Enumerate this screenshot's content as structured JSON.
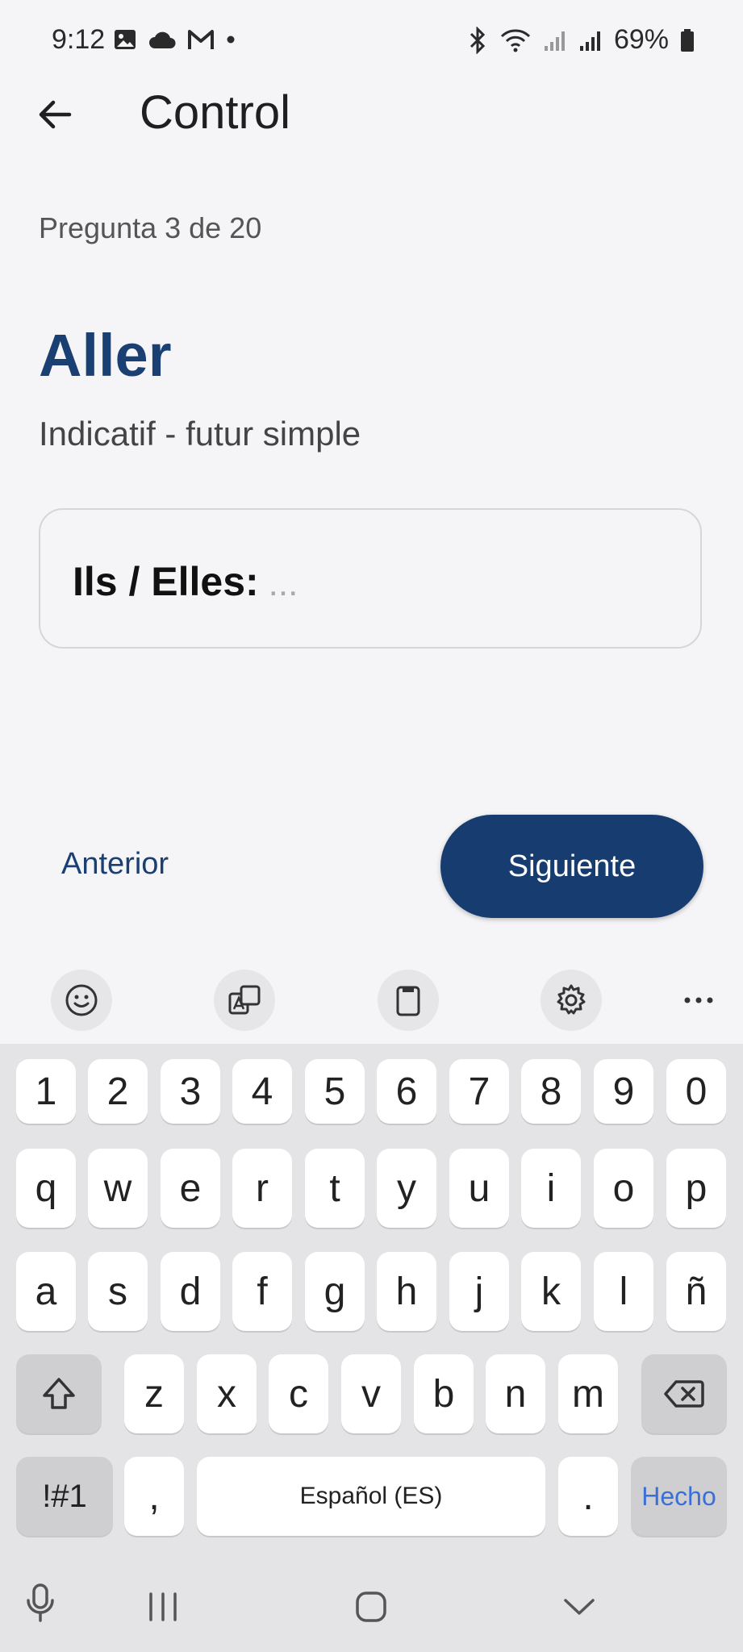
{
  "status_bar": {
    "time": "9:12",
    "battery": "69%"
  },
  "app_bar": {
    "title": "Control"
  },
  "quiz": {
    "progress": "Pregunta 3 de 20",
    "verb": "Aller",
    "tense": "Indicatif - futur simple",
    "prompt": "Ils / Elles:",
    "answer_placeholder": "..."
  },
  "buttons": {
    "previous": "Anterior",
    "next": "Siguiente"
  },
  "keyboard": {
    "number_row": [
      "1",
      "2",
      "3",
      "4",
      "5",
      "6",
      "7",
      "8",
      "9",
      "0"
    ],
    "row1": [
      "q",
      "w",
      "e",
      "r",
      "t",
      "y",
      "u",
      "i",
      "o",
      "p"
    ],
    "row2": [
      "a",
      "s",
      "d",
      "f",
      "g",
      "h",
      "j",
      "k",
      "l",
      "ñ"
    ],
    "row3": [
      "z",
      "x",
      "c",
      "v",
      "b",
      "n",
      "m"
    ],
    "symbols_label": "!#1",
    "comma": ",",
    "space_label": "Español (ES)",
    "period": ".",
    "done_label": "Hecho",
    "done_color": "#3a6fd8"
  },
  "colors": {
    "accent": "#173d70",
    "verb": "#1a3f73"
  }
}
